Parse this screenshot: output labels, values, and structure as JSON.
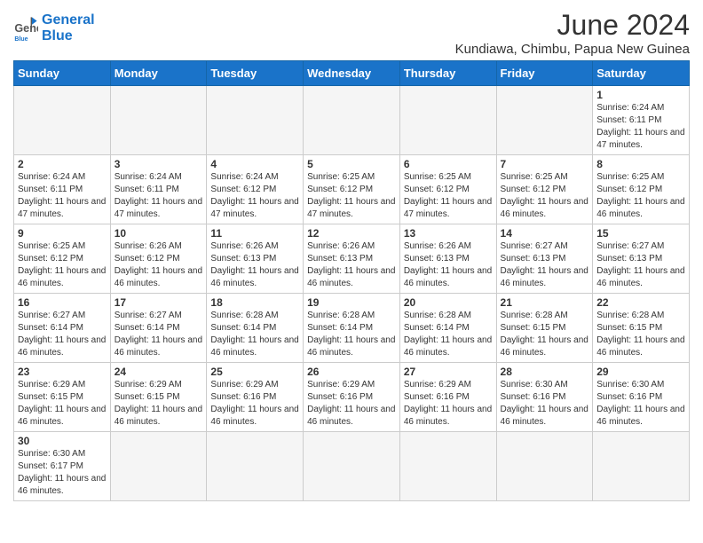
{
  "header": {
    "title": "June 2024",
    "location": "Kundiawa, Chimbu, Papua New Guinea",
    "logo_general": "General",
    "logo_blue": "Blue"
  },
  "weekdays": [
    "Sunday",
    "Monday",
    "Tuesday",
    "Wednesday",
    "Thursday",
    "Friday",
    "Saturday"
  ],
  "weeks": [
    [
      {
        "day": null,
        "info": null
      },
      {
        "day": null,
        "info": null
      },
      {
        "day": null,
        "info": null
      },
      {
        "day": null,
        "info": null
      },
      {
        "day": null,
        "info": null
      },
      {
        "day": null,
        "info": null
      },
      {
        "day": "1",
        "info": "Sunrise: 6:24 AM\nSunset: 6:11 PM\nDaylight: 11 hours and 47 minutes."
      }
    ],
    [
      {
        "day": "2",
        "info": "Sunrise: 6:24 AM\nSunset: 6:11 PM\nDaylight: 11 hours and 47 minutes."
      },
      {
        "day": "3",
        "info": "Sunrise: 6:24 AM\nSunset: 6:11 PM\nDaylight: 11 hours and 47 minutes."
      },
      {
        "day": "4",
        "info": "Sunrise: 6:24 AM\nSunset: 6:12 PM\nDaylight: 11 hours and 47 minutes."
      },
      {
        "day": "5",
        "info": "Sunrise: 6:25 AM\nSunset: 6:12 PM\nDaylight: 11 hours and 47 minutes."
      },
      {
        "day": "6",
        "info": "Sunrise: 6:25 AM\nSunset: 6:12 PM\nDaylight: 11 hours and 47 minutes."
      },
      {
        "day": "7",
        "info": "Sunrise: 6:25 AM\nSunset: 6:12 PM\nDaylight: 11 hours and 46 minutes."
      },
      {
        "day": "8",
        "info": "Sunrise: 6:25 AM\nSunset: 6:12 PM\nDaylight: 11 hours and 46 minutes."
      }
    ],
    [
      {
        "day": "9",
        "info": "Sunrise: 6:25 AM\nSunset: 6:12 PM\nDaylight: 11 hours and 46 minutes."
      },
      {
        "day": "10",
        "info": "Sunrise: 6:26 AM\nSunset: 6:12 PM\nDaylight: 11 hours and 46 minutes."
      },
      {
        "day": "11",
        "info": "Sunrise: 6:26 AM\nSunset: 6:13 PM\nDaylight: 11 hours and 46 minutes."
      },
      {
        "day": "12",
        "info": "Sunrise: 6:26 AM\nSunset: 6:13 PM\nDaylight: 11 hours and 46 minutes."
      },
      {
        "day": "13",
        "info": "Sunrise: 6:26 AM\nSunset: 6:13 PM\nDaylight: 11 hours and 46 minutes."
      },
      {
        "day": "14",
        "info": "Sunrise: 6:27 AM\nSunset: 6:13 PM\nDaylight: 11 hours and 46 minutes."
      },
      {
        "day": "15",
        "info": "Sunrise: 6:27 AM\nSunset: 6:13 PM\nDaylight: 11 hours and 46 minutes."
      }
    ],
    [
      {
        "day": "16",
        "info": "Sunrise: 6:27 AM\nSunset: 6:14 PM\nDaylight: 11 hours and 46 minutes."
      },
      {
        "day": "17",
        "info": "Sunrise: 6:27 AM\nSunset: 6:14 PM\nDaylight: 11 hours and 46 minutes."
      },
      {
        "day": "18",
        "info": "Sunrise: 6:28 AM\nSunset: 6:14 PM\nDaylight: 11 hours and 46 minutes."
      },
      {
        "day": "19",
        "info": "Sunrise: 6:28 AM\nSunset: 6:14 PM\nDaylight: 11 hours and 46 minutes."
      },
      {
        "day": "20",
        "info": "Sunrise: 6:28 AM\nSunset: 6:14 PM\nDaylight: 11 hours and 46 minutes."
      },
      {
        "day": "21",
        "info": "Sunrise: 6:28 AM\nSunset: 6:15 PM\nDaylight: 11 hours and 46 minutes."
      },
      {
        "day": "22",
        "info": "Sunrise: 6:28 AM\nSunset: 6:15 PM\nDaylight: 11 hours and 46 minutes."
      }
    ],
    [
      {
        "day": "23",
        "info": "Sunrise: 6:29 AM\nSunset: 6:15 PM\nDaylight: 11 hours and 46 minutes."
      },
      {
        "day": "24",
        "info": "Sunrise: 6:29 AM\nSunset: 6:15 PM\nDaylight: 11 hours and 46 minutes."
      },
      {
        "day": "25",
        "info": "Sunrise: 6:29 AM\nSunset: 6:16 PM\nDaylight: 11 hours and 46 minutes."
      },
      {
        "day": "26",
        "info": "Sunrise: 6:29 AM\nSunset: 6:16 PM\nDaylight: 11 hours and 46 minutes."
      },
      {
        "day": "27",
        "info": "Sunrise: 6:29 AM\nSunset: 6:16 PM\nDaylight: 11 hours and 46 minutes."
      },
      {
        "day": "28",
        "info": "Sunrise: 6:30 AM\nSunset: 6:16 PM\nDaylight: 11 hours and 46 minutes."
      },
      {
        "day": "29",
        "info": "Sunrise: 6:30 AM\nSunset: 6:16 PM\nDaylight: 11 hours and 46 minutes."
      }
    ],
    [
      {
        "day": "30",
        "info": "Sunrise: 6:30 AM\nSunset: 6:17 PM\nDaylight: 11 hours and 46 minutes."
      },
      {
        "day": null,
        "info": null
      },
      {
        "day": null,
        "info": null
      },
      {
        "day": null,
        "info": null
      },
      {
        "day": null,
        "info": null
      },
      {
        "day": null,
        "info": null
      },
      {
        "day": null,
        "info": null
      }
    ]
  ]
}
